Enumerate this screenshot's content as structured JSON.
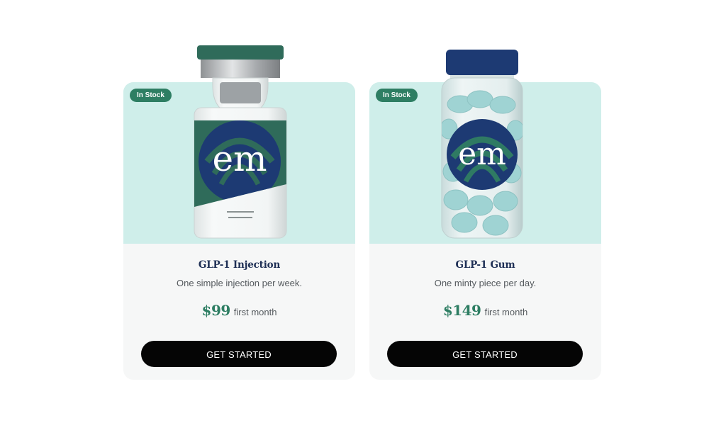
{
  "products": [
    {
      "badge": "In Stock",
      "logo_text": "em",
      "name": "GLP-1 Injection",
      "description": "One simple injection per week.",
      "price": "$99",
      "price_note": "first month",
      "cta_label": "GET STARTED"
    },
    {
      "badge": "In Stock",
      "logo_text": "em",
      "name": "GLP-1 Gum",
      "description": "One minty piece per day.",
      "price": "$149",
      "price_note": "first month",
      "cta_label": "GET STARTED"
    }
  ],
  "colors": {
    "hero_bg": "#cfeeea",
    "badge_bg": "#2e7e63",
    "price": "#2e7e63",
    "title": "#1e2f55",
    "button_bg": "#050505",
    "vial_cap": "#2f6b5a",
    "jar_lid": "#1d3a73"
  },
  "icons": [
    "vial-image",
    "gum-jar-image"
  ]
}
